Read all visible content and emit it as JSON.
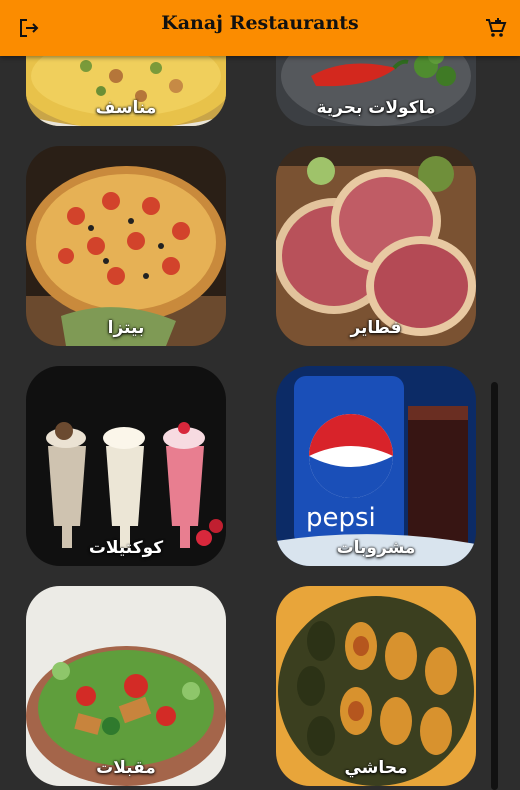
{
  "app": {
    "title": "Kanaj Restaurants"
  },
  "icons": {
    "logout": "logout-icon",
    "cart": "add-shopping-cart-icon"
  },
  "colors": {
    "appbar": "#fb8c00",
    "background": "#2d2d2d"
  },
  "categories": [
    {
      "label": "مناسف"
    },
    {
      "label": "ماكولات بحرية"
    },
    {
      "label": "بيتزا"
    },
    {
      "label": "فطاير"
    },
    {
      "label": "كوكتيلات"
    },
    {
      "label": "مشروبات"
    },
    {
      "label": "مقبلات"
    },
    {
      "label": "محاشي"
    }
  ]
}
